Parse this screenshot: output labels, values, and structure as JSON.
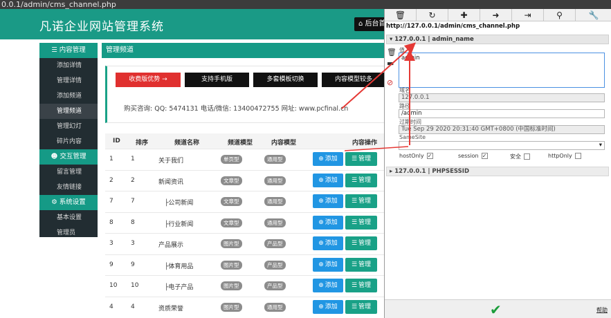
{
  "browser": {
    "url": "0.0.1/admin/cms_channel.php"
  },
  "header": {
    "title": "凡诺企业网站管理系统",
    "back_label": "后台首"
  },
  "sidebar": {
    "groups": [
      {
        "title": "内容管理",
        "icon": "list-icon",
        "items": [
          "添加详情",
          "管理详情",
          "添加频道",
          "管理频道",
          "管理幻灯",
          "碎片内容"
        ]
      },
      {
        "title": "交互管理",
        "icon": "users-icon",
        "items": [
          "留言管理",
          "友情链接"
        ]
      },
      {
        "title": "系统设置",
        "icon": "gear-icon",
        "items": [
          "基本设置",
          "管理员"
        ]
      }
    ],
    "active_item": "管理频道"
  },
  "main": {
    "title": "管理频道",
    "promo_buttons": [
      "收费版优势 →",
      "支持手机版",
      "多套模板切换",
      "内容模型较多"
    ],
    "contact": "购买咨询:  QQ: 5474131     电话/微信: 13400472755     网址: www.pcfinal.cn"
  },
  "table": {
    "headers": [
      "ID",
      "排序",
      "频道名称",
      "频道模型",
      "内容模型",
      "内容操作"
    ],
    "add_label": "添加",
    "manage_label": "管理",
    "rows": [
      {
        "id": "1",
        "sort": "1",
        "name": "关于我们",
        "channel_model": "单页型",
        "content_model": "通用型"
      },
      {
        "id": "2",
        "sort": "2",
        "name": "新闻资讯",
        "channel_model": "文章型",
        "content_model": "通用型"
      },
      {
        "id": "7",
        "sort": "7",
        "name": "├公司新闻",
        "channel_model": "文章型",
        "content_model": "通用型"
      },
      {
        "id": "8",
        "sort": "8",
        "name": "├行业新闻",
        "channel_model": "文章型",
        "content_model": "通用型"
      },
      {
        "id": "3",
        "sort": "3",
        "name": "产品展示",
        "channel_model": "图片型",
        "content_model": "产品型"
      },
      {
        "id": "9",
        "sort": "9",
        "name": "├体育用品",
        "channel_model": "图片型",
        "content_model": "产品型"
      },
      {
        "id": "10",
        "sort": "10",
        "name": "├电子产品",
        "channel_model": "图片型",
        "content_model": "产品型"
      },
      {
        "id": "4",
        "sort": "4",
        "name": "资质荣誉",
        "channel_model": "图片型",
        "content_model": "通用型"
      }
    ]
  },
  "cookie_editor": {
    "toolbar_icons": [
      "trash-icon",
      "undo-icon",
      "plus-icon",
      "import-icon",
      "export-icon",
      "search-icon",
      "wrench-icon"
    ],
    "page_url": "http://127.0.0.1/admin/cms_channel.php",
    "cookie_header": "127.0.0.1 | admin_name",
    "value_label": "值",
    "value": "admin",
    "domain_label": "域名",
    "domain": "127.0.0.1",
    "path_label": "路径",
    "path": "/admin",
    "expires_label": "过期时间",
    "expires": "Tue Sep 29 2020 20:31:40 GMT+0800 (中国标准时间)",
    "samesite_label": "SameSite",
    "samesite_value": "",
    "flags": [
      {
        "label": "hostOnly",
        "checked": true
      },
      {
        "label": "session",
        "checked": true
      },
      {
        "label": "安全",
        "checked": false
      },
      {
        "label": "httpOnly",
        "checked": false
      }
    ],
    "second_cookie_header": "127.0.0.1 | PHPSESSID",
    "help_label": "帮助"
  },
  "colors": {
    "teal": "#159a86",
    "sidebar_bg": "#222d32",
    "red": "#e0302f",
    "blue": "#2196e3",
    "annotation": "#e53935"
  }
}
